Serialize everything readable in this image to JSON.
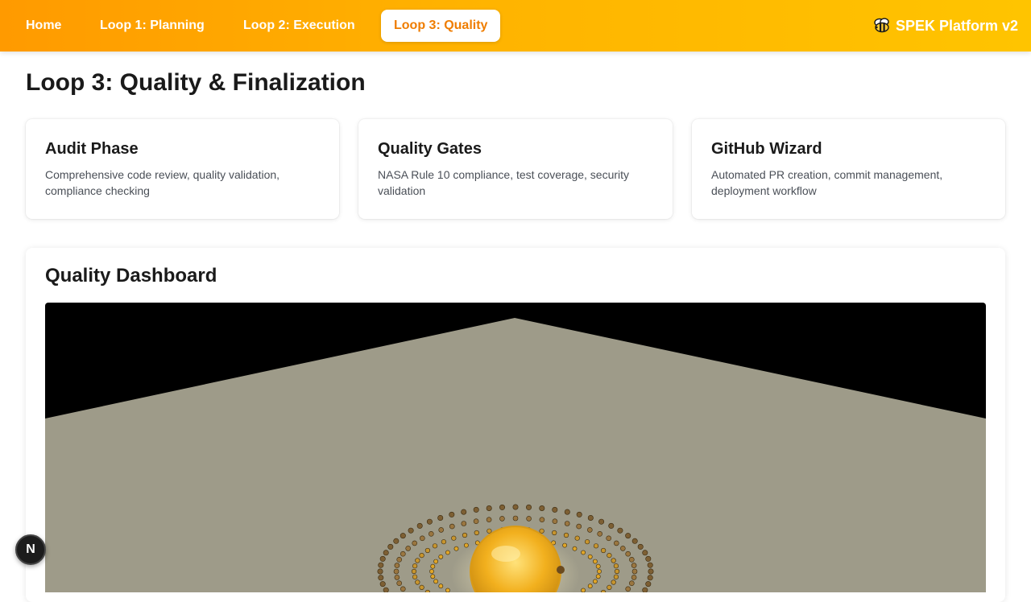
{
  "nav": {
    "items": [
      {
        "label": "Home",
        "active": false
      },
      {
        "label": "Loop 1: Planning",
        "active": false
      },
      {
        "label": "Loop 2: Execution",
        "active": false
      },
      {
        "label": "Loop 3: Quality",
        "active": true
      }
    ],
    "brand": {
      "icon": "bee-icon",
      "label": "SPEK Platform v2"
    }
  },
  "page": {
    "title": "Loop 3: Quality & Finalization"
  },
  "cards": [
    {
      "title": "Audit Phase",
      "description": "Comprehensive code review, quality validation, compliance checking"
    },
    {
      "title": "Quality Gates",
      "description": "NASA Rule 10 compliance, test coverage, security validation"
    },
    {
      "title": "GitHub Wizard",
      "description": "Automated PR creation, commit management, deployment workflow"
    }
  ],
  "dashboard": {
    "title": "Quality Dashboard",
    "scene": {
      "background": "#000000",
      "floor_color": "#9e9b89",
      "core_color": "#f2b01e",
      "ring_color": "#8a6a3a"
    }
  },
  "floating_badge": {
    "label": "N",
    "icon": "n-logo-icon"
  },
  "colors": {
    "accent_start": "#ff9a00",
    "accent_end": "#ffc400",
    "active_text": "#ef7d00"
  }
}
